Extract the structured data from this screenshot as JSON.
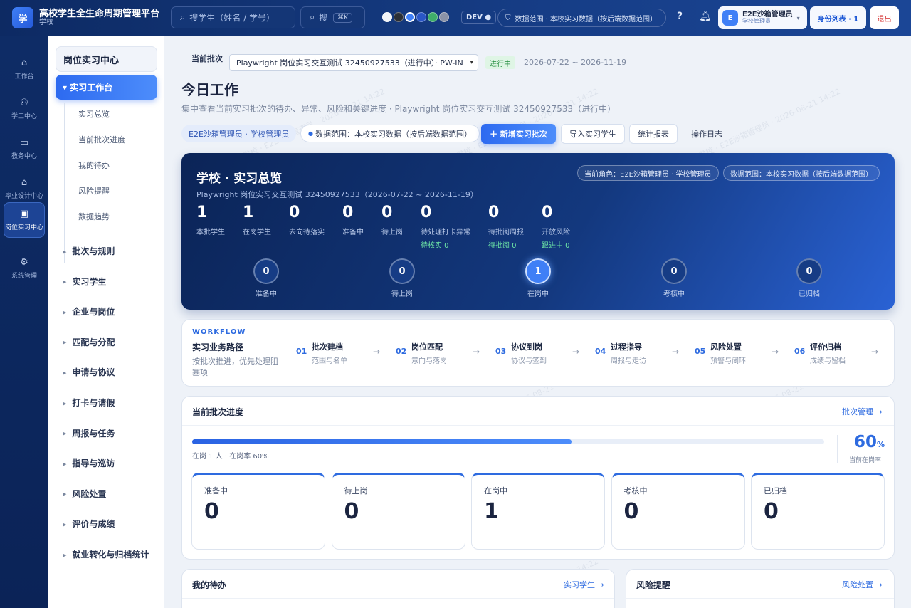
{
  "app": {
    "logo": "学",
    "title": "高校学生全生命周期管理平台",
    "subtitle": "学校"
  },
  "topbar": {
    "search_placeholder": "搜学生（姓名 / 学号）",
    "search2_placeholder": "搜",
    "shortcut": "⌘K",
    "env": "DEV ●",
    "scope": "数据范围 · 本校实习数据（按后端数据范围）",
    "theme_colors": [
      "#f2f4f8",
      "#2b2f36",
      "#3f7ff6",
      "#2a56c6",
      "#3fae6a",
      "#8a93a8"
    ],
    "help_icon": "?",
    "bell_icon": "bell-icon",
    "user_initial": "E",
    "user_name": "E2E沙箱管理员",
    "user_role": "学校管理员",
    "role_btn": "身份列表 · 1",
    "logout": "退出"
  },
  "rail": [
    {
      "label": "工作台",
      "icon": "home-icon",
      "glyph": "⌂"
    },
    {
      "label": "学工中心",
      "icon": "users-icon",
      "glyph": "⚇"
    },
    {
      "label": "教务中心",
      "icon": "book-icon",
      "glyph": "▭"
    },
    {
      "label": "毕业设计中心",
      "icon": "cap-icon",
      "glyph": "⌂"
    },
    {
      "label": "岗位实习中心",
      "icon": "briefcase-icon",
      "glyph": "▣"
    },
    {
      "label": "系统管理",
      "icon": "gear-icon",
      "glyph": "⚙"
    }
  ],
  "nav": {
    "header": "岗位实习中心",
    "active": "▾ 实习工作台",
    "subs": [
      "实习总览",
      "当前批次进度",
      "我的待办",
      "风险提醒",
      "数据趋势"
    ],
    "groups": [
      "批次与规则",
      "实习学生",
      "企业与岗位",
      "匹配与分配",
      "申请与协议",
      "打卡与请假",
      "周报与任务",
      "指导与巡访",
      "风险处置",
      "评价与成绩",
      "就业转化与归档统计"
    ]
  },
  "batch": {
    "label": "当前批次",
    "selected": "Playwright 岗位实习交互测试 32450927533（进行中）· PW-IN",
    "status": "进行中",
    "range": "2026-07-22 ~ 2026-11-19"
  },
  "page": {
    "title": "今日工作",
    "subtitle": "集中查看当前实习批次的待办、异常、风险和关键进度 · Playwright 岗位实习交互测试 32450927533（进行中）",
    "role_pill": "E2E沙箱管理员 · 学校管理员",
    "scope_pill": "数据范围：本校实习数据（按后端数据范围）",
    "actions": {
      "new": "＋ 新增实习批次",
      "import": "导入实习学生",
      "report": "统计报表",
      "log": "操作日志"
    }
  },
  "hero": {
    "title": "学校 · 实习总览",
    "subtitle": "Playwright 岗位实习交互测试 32450927533（2026-07-22 ~ 2026-11-19）",
    "role_tag": "当前角色：E2E沙箱管理员 · 学校管理员",
    "scope_tag": "数据范围：本校实习数据（按后端数据范围）",
    "stats": [
      {
        "value": "1",
        "label": "本批学生",
        "extra": ""
      },
      {
        "value": "1",
        "label": "在岗学生",
        "extra": ""
      },
      {
        "value": "0",
        "label": "去向待落实",
        "extra": ""
      },
      {
        "value": "0",
        "label": "准备中",
        "extra": ""
      },
      {
        "value": "0",
        "label": "待上岗",
        "extra": ""
      },
      {
        "value": "0",
        "label": "待处理打卡异常",
        "extra": "待核实 0"
      },
      {
        "value": "0",
        "label": "待批阅周报",
        "extra": "待批阅 0"
      },
      {
        "value": "0",
        "label": "开放风险",
        "extra": "跟进中 0"
      }
    ],
    "stages": [
      {
        "value": "0",
        "label": "准备中",
        "active": false
      },
      {
        "value": "0",
        "label": "待上岗",
        "active": false
      },
      {
        "value": "1",
        "label": "在岗中",
        "active": true
      },
      {
        "value": "0",
        "label": "考核中",
        "active": false
      },
      {
        "value": "0",
        "label": "已归档",
        "active": false
      }
    ]
  },
  "workflow": {
    "tag": "WORKFLOW",
    "title": "实习业务路径",
    "desc": "按批次推进，优先处理阻塞项",
    "steps": [
      {
        "no": "01",
        "title": "批次建档",
        "desc": "范围与名单"
      },
      {
        "no": "02",
        "title": "岗位匹配",
        "desc": "意向与落岗"
      },
      {
        "no": "03",
        "title": "协议到岗",
        "desc": "协议与签到"
      },
      {
        "no": "04",
        "title": "过程指导",
        "desc": "周报与走访"
      },
      {
        "no": "05",
        "title": "风险处置",
        "desc": "预警与闭环"
      },
      {
        "no": "06",
        "title": "评价归档",
        "desc": "成绩与留档"
      }
    ]
  },
  "progress": {
    "title": "当前批次进度",
    "link": "批次管理 →",
    "rate": 0.6,
    "rate_text": "60",
    "rate_unit": "%",
    "rate_label": "当前在岗率",
    "summary": "在岗 1 人 · 在岗率 60%",
    "cards": [
      {
        "label": "准备中",
        "value": "0"
      },
      {
        "label": "待上岗",
        "value": "0"
      },
      {
        "label": "在岗中",
        "value": "1"
      },
      {
        "label": "考核中",
        "value": "0"
      },
      {
        "label": "已归档",
        "value": "0"
      }
    ]
  },
  "bottom": {
    "todo_title": "我的待办",
    "todo_link": "实习学生 →",
    "risk_title": "风险提醒",
    "risk_link": "风险处置 →"
  },
  "watermark": "沙箱学校 · E2E沙箱管理员 · 2026-08-21 14:22"
}
